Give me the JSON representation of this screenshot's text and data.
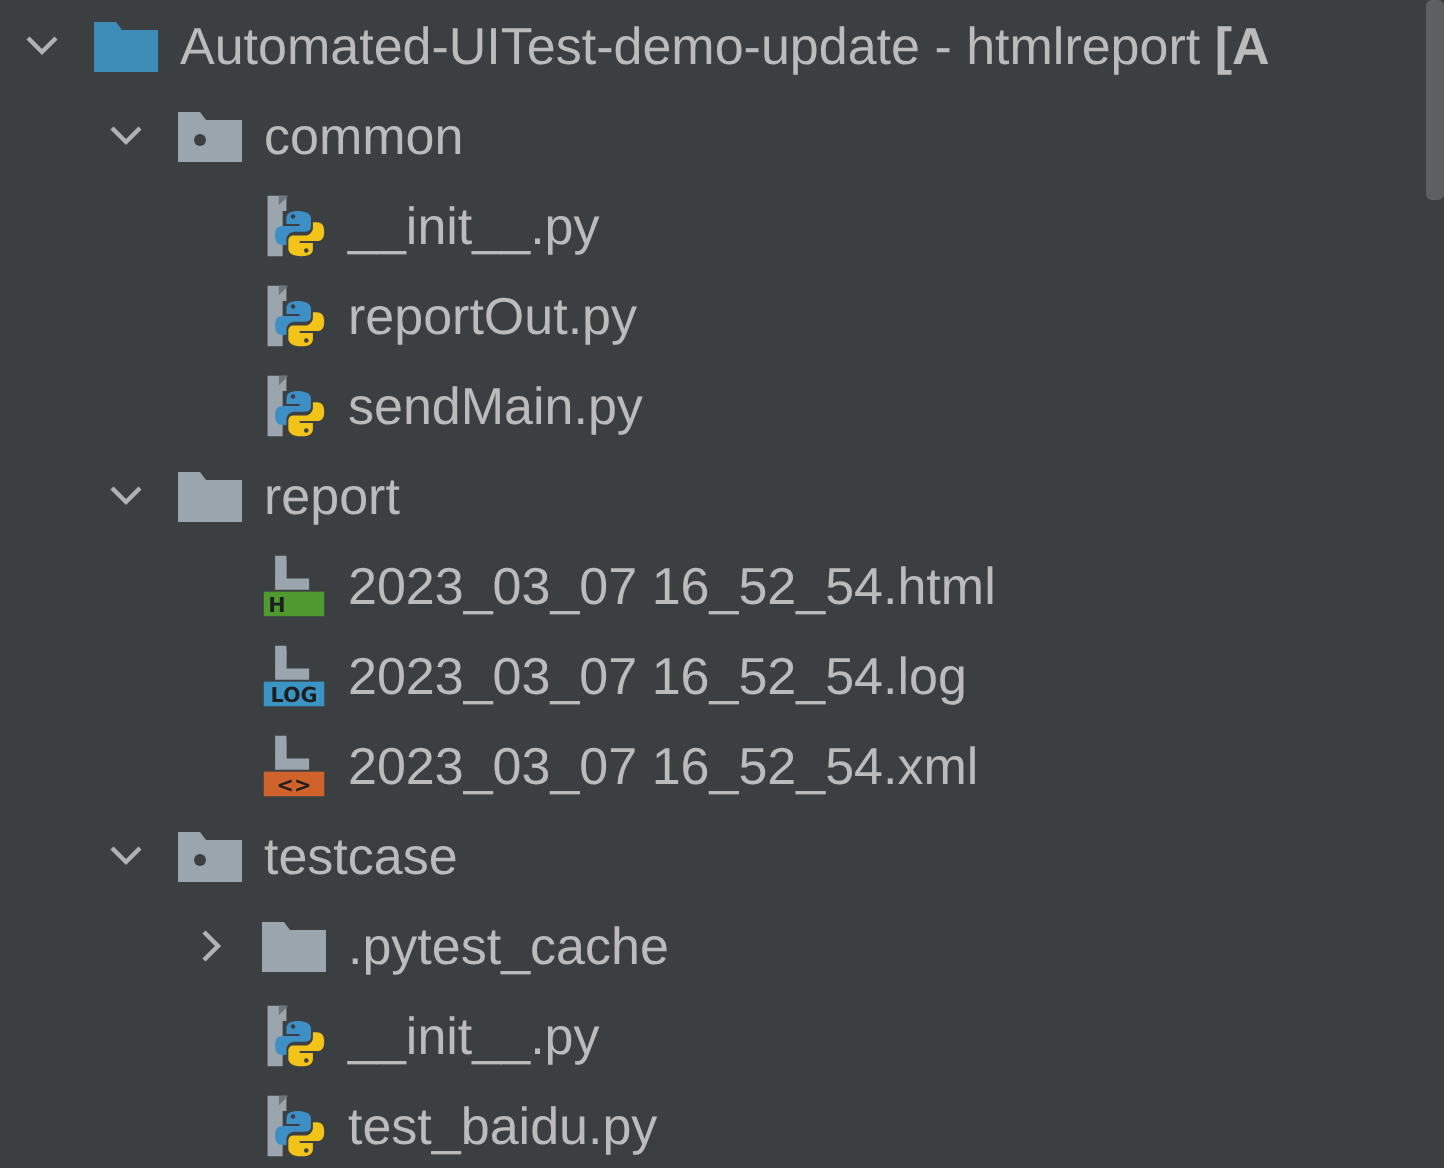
{
  "tree": {
    "kind": "root",
    "label": "Automated-UITest-demo-update - htmlreport **[A**",
    "expanded": true,
    "children": [
      {
        "kind": "package",
        "label": "common",
        "expanded": true,
        "children": [
          {
            "kind": "py",
            "label": "__init__.py"
          },
          {
            "kind": "py",
            "label": "reportOut.py"
          },
          {
            "kind": "py",
            "label": "sendMain.py"
          }
        ]
      },
      {
        "kind": "folder",
        "label": "report",
        "expanded": true,
        "children": [
          {
            "kind": "html",
            "label": "2023_03_07 16_52_54.html",
            "badge": "H"
          },
          {
            "kind": "log",
            "label": "2023_03_07 16_52_54.log",
            "badge": "LOG"
          },
          {
            "kind": "xml",
            "label": "2023_03_07 16_52_54.xml",
            "badge": "<>"
          }
        ]
      },
      {
        "kind": "package",
        "label": "testcase",
        "expanded": true,
        "children": [
          {
            "kind": "folder",
            "label": ".pytest_cache",
            "expanded": false
          },
          {
            "kind": "py",
            "label": "__init__.py"
          },
          {
            "kind": "py",
            "label": "test_baidu.py"
          }
        ]
      }
    ]
  }
}
